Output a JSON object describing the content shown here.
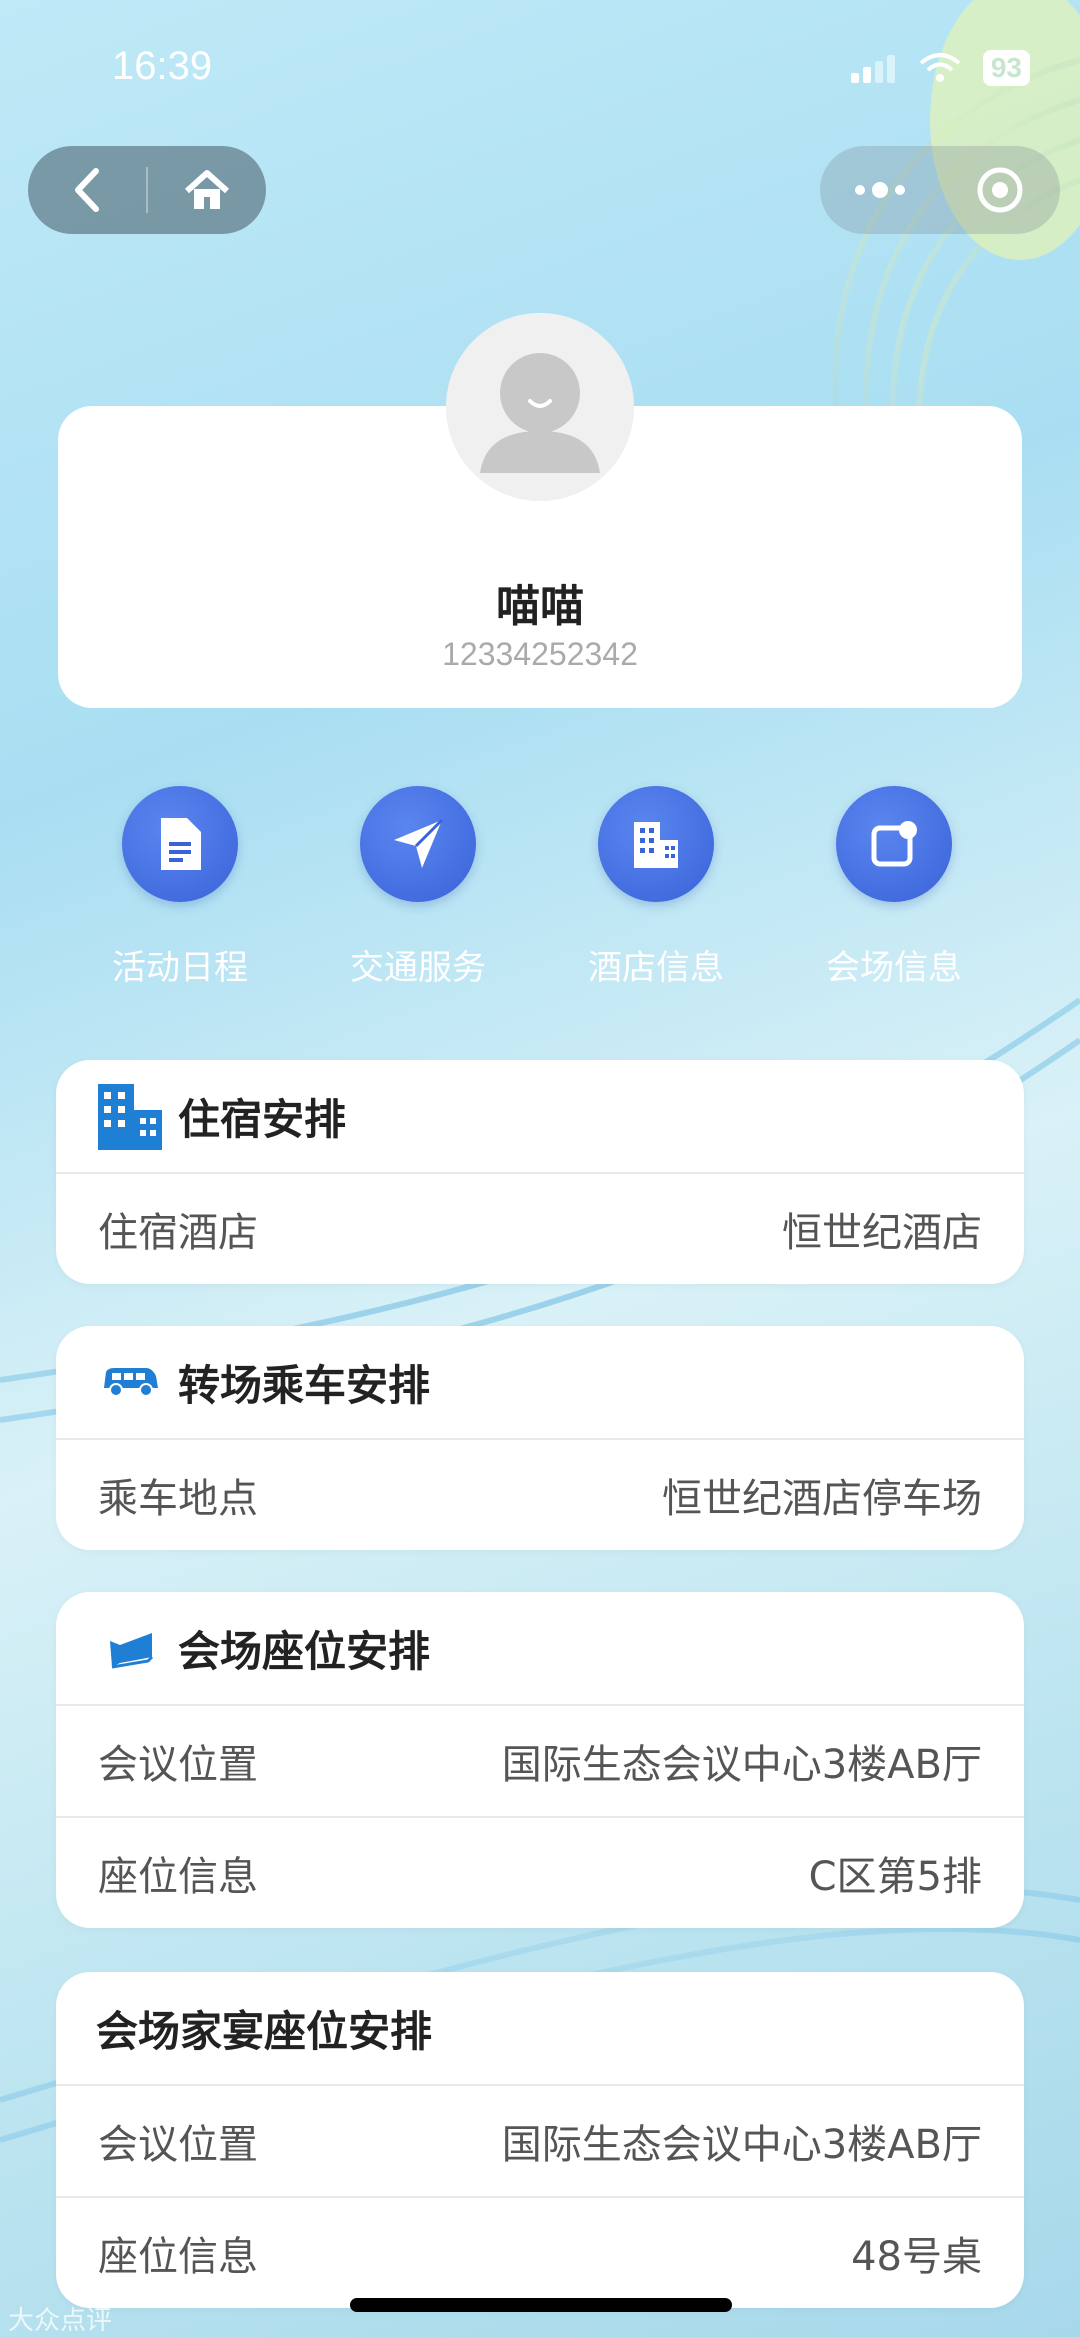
{
  "status": {
    "time": "16:39",
    "battery": "93"
  },
  "nav": {
    "back_icon": "chevron-left-icon",
    "home_icon": "home-icon",
    "more_icon": "more-dots-icon",
    "close_icon": "target-icon"
  },
  "profile": {
    "name": "喵喵",
    "phone": "12334252342"
  },
  "quick_actions": [
    {
      "label": "活动日程",
      "icon": "document-icon"
    },
    {
      "label": "交通服务",
      "icon": "navigation-icon"
    },
    {
      "label": "酒店信息",
      "icon": "building-icon"
    },
    {
      "label": "会场信息",
      "icon": "venue-icon"
    }
  ],
  "sections": {
    "hotel": {
      "title": "住宿安排",
      "rows": [
        {
          "label": "住宿酒店",
          "value": "恒世纪酒店"
        }
      ]
    },
    "transfer": {
      "title": "转场乘车安排",
      "rows": [
        {
          "label": "乘车地点",
          "value": "恒世纪酒店停车场"
        }
      ]
    },
    "seat": {
      "title": "会场座位安排",
      "rows": [
        {
          "label": "会议位置",
          "value": "国际生态会议中心3楼AB厅"
        },
        {
          "label": "座位信息",
          "value": "C区第5排"
        }
      ]
    },
    "banquet": {
      "title": "会场家宴座位安排",
      "rows": [
        {
          "label": "会议位置",
          "value": "国际生态会议中心3楼AB厅"
        },
        {
          "label": "座位信息",
          "value": "48号桌"
        }
      ]
    }
  },
  "watermark": "大众点评",
  "colors": {
    "accent": "#3a63d8",
    "icon_blue": "#1f7fd4"
  }
}
